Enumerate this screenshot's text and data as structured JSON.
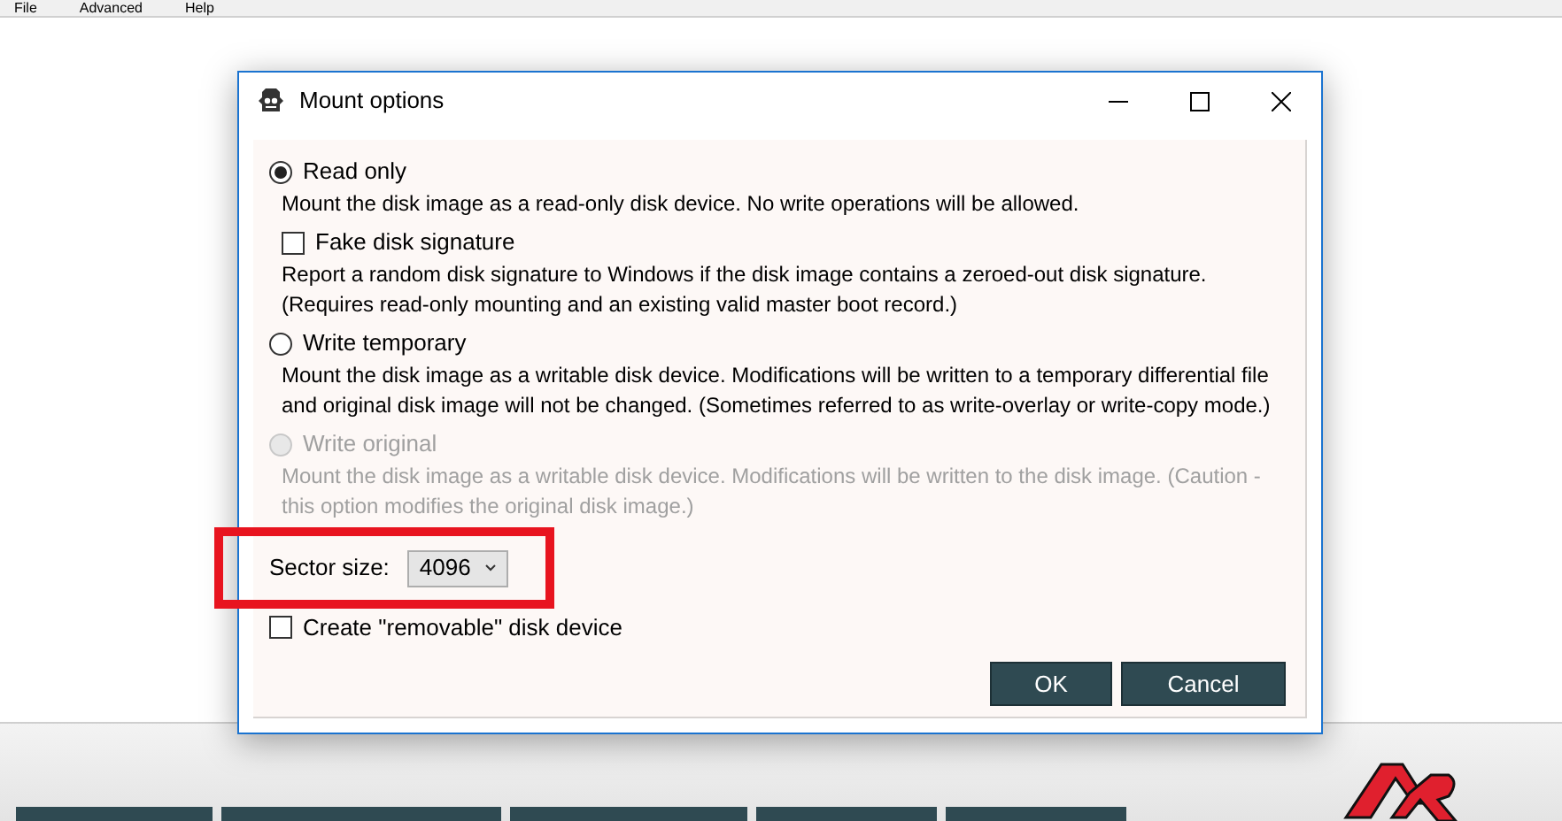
{
  "menu": [
    "File",
    "Advanced",
    "Help"
  ],
  "dialog": {
    "title": "Mount options",
    "options": [
      {
        "kind": "radio",
        "label": "Read only",
        "selected": true,
        "disabled": false,
        "description": "Mount the disk image as a read-only disk device. No write operations will be allowed."
      },
      {
        "kind": "checkbox",
        "label": "Fake disk signature",
        "checked": false,
        "disabled": false,
        "description": "Report a random disk signature to Windows if the disk image contains a zeroed-out disk signature. (Requires read-only mounting and an existing valid master boot record.)"
      },
      {
        "kind": "radio",
        "label": "Write temporary",
        "selected": false,
        "disabled": false,
        "description": "Mount the disk image as a writable disk device. Modifications will be written to a temporary differential file and original disk image will not be changed. (Sometimes referred to as write-overlay or write-copy mode.)"
      },
      {
        "kind": "radio",
        "label": "Write original",
        "selected": false,
        "disabled": true,
        "description": "Mount the disk image as a writable disk device. Modifications will be written to the disk image. (Caution - this option modifies the original disk image.)"
      }
    ],
    "sector_size": {
      "label": "Sector size:",
      "value": "4096"
    },
    "removable": {
      "label": "Create \"removable\" disk device",
      "checked": false
    },
    "buttons": [
      "OK",
      "Cancel"
    ]
  }
}
